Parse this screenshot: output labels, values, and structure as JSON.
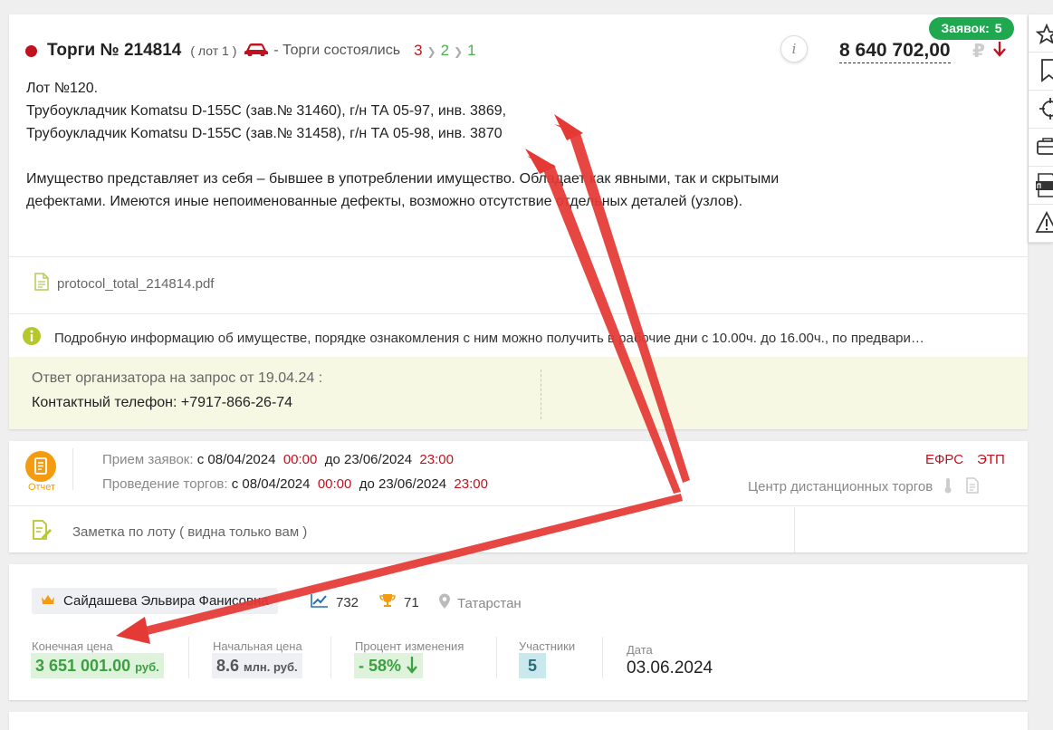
{
  "header": {
    "bids_label": "Заявок:",
    "bids_count": "5",
    "title": "Торги № 214814",
    "lot": "( лот 1 )",
    "status": "- Торги состоялись",
    "steps": [
      "3",
      "2",
      "1"
    ],
    "price": "8 640 702,00",
    "currency": "₽",
    "info_glyph": "i"
  },
  "description": {
    "line1": "Лот №120.",
    "line2": "Трубоукладчик Komatsu D-155C (зав.№ 31460), г/н ТА 05-97, инв. 3869,",
    "line3": "Трубоукладчик Komatsu D-155C (зав.№ 31458), г/н ТА 05-98, инв. 3870",
    "para": "Имущество представляет из себя – бывшее в употреблении имущество. Обладает как явными, так и скрытыми дефектами. Имеются иные непоименованные дефекты, возможно отсутствие отдельных деталей (узлов)."
  },
  "file": {
    "name": "protocol_total_214814.pdf"
  },
  "info_notice": "Подробную информацию об имуществе, порядке ознакомления с ним можно получить в рабочие дни с 10.00ч. до 16.00ч., по предвари…",
  "organizer": {
    "header": "Ответ организатора на запрос от 19.04.24 :",
    "value": "Контактный телефон: +7917-866-26-74"
  },
  "schedule": {
    "report_label": "Отчет",
    "accept_label": "Прием заявок:",
    "accept_from_prefix": "с",
    "accept_from_date": "08/04/2024",
    "accept_from_time": "00:00",
    "accept_to_prefix": "до",
    "accept_to_date": "23/06/2024",
    "accept_to_time": "23:00",
    "trade_label": "Проведение торгов:",
    "trade_from_prefix": "с",
    "trade_from_date": "08/04/2024",
    "trade_from_time": "00:00",
    "trade_to_prefix": "до",
    "trade_to_date": "23/06/2024",
    "trade_to_time": "23:00",
    "efrs": "ЕФРС",
    "etp": "ЭТП",
    "platform": "Центр дистанционных торгов",
    "note": "Заметка по лоту ( видна только вам )"
  },
  "result": {
    "winner": "Сайдашева Эльвира Фанисовна",
    "trend_count": "732",
    "trophy_count": "71",
    "region": "Татарстан",
    "final_label": "Конечная цена",
    "final_value": "3 651 001.00",
    "final_unit": "руб.",
    "start_label": "Начальная цена",
    "start_value": "8.6",
    "start_unit": "млн. руб.",
    "pct_label": "Процент изменения",
    "pct_value": "- 58%",
    "participants_label": "Участники",
    "participants_value": "5",
    "date_label": "Дата",
    "date_value": "03.06.2024"
  },
  "sidebar": {
    "buttons": [
      "star-icon",
      "bookmark-icon",
      "target-icon",
      "briefcase-icon",
      "pdf-icon",
      "warning-icon"
    ]
  },
  "colors": {
    "accent_green": "#1fa84f",
    "alert_red": "#c1121f",
    "annotation_red": "#e53935",
    "report_orange": "#f39c12"
  }
}
